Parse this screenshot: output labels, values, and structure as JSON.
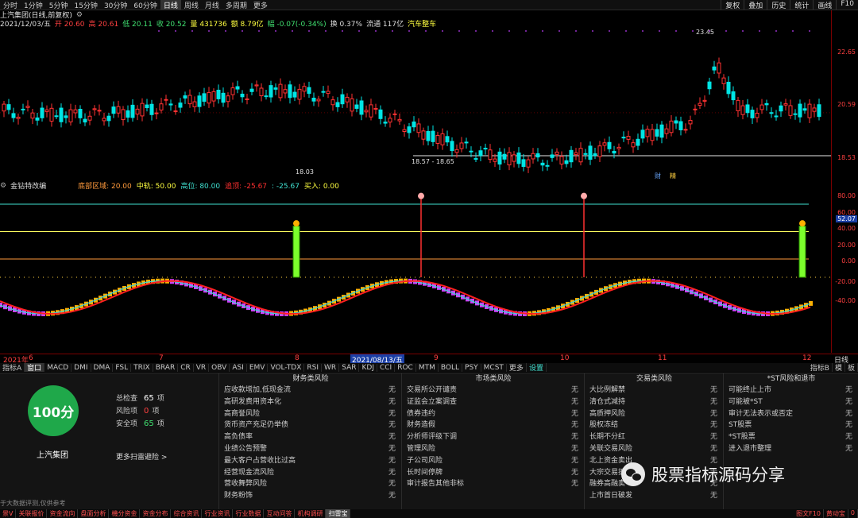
{
  "topbar": {
    "periods": [
      "分时",
      "1分钟",
      "5分钟",
      "15分钟",
      "30分钟",
      "60分钟",
      "日线",
      "周线",
      "月线",
      "多周期",
      "更多"
    ],
    "active": "日线",
    "right": [
      "复权",
      "叠加",
      "历史",
      "统计",
      "画线",
      "F10"
    ]
  },
  "stock": {
    "title": "上汽集团(日线,前复权)",
    "info_date": "2021/12/03/五",
    "open": "开 20.60",
    "high": "高 20.61",
    "low": "低 20.11",
    "close": "收 20.52",
    "volume": "量 431736",
    "amount": "额 8.79亿",
    "change": "幅 -0.07(-0.34%)",
    "turnover": "换 0.37%",
    "float": "流通 117亿",
    "sector": "汽车整车"
  },
  "price_chart": {
    "y_labels": [
      "22.65",
      "20.59",
      "18.53"
    ],
    "max_label": "23.45",
    "min_label": "18.03",
    "range_label": "18.57 - 18.65",
    "marks": [
      "财",
      "精"
    ]
  },
  "indicator": {
    "name": "金钻特改编",
    "params": [
      {
        "text": "底部区域: 20.00",
        "color": "#ff9a3c"
      },
      {
        "text": "中轨: 50.00",
        "color": "#ffff40"
      },
      {
        "text": "高位: 80.00",
        "color": "#40e0d0"
      },
      {
        "text": "追顶: -25.67",
        "color": "#ff3030"
      },
      {
        "text": ": -25.67",
        "color": "#40e0d0"
      },
      {
        "text": "买入: 0.00",
        "color": "#ffff40"
      }
    ],
    "y_labels": [
      "80.00",
      "60.00",
      "40.00",
      "20.00",
      "0.00",
      "-20.00",
      "-40.00"
    ],
    "current_value": "52.07"
  },
  "chart_data": {
    "type": "candlestick",
    "x_ticks": [
      "2021年",
      "6",
      "7",
      "8",
      "2021/08/13/五",
      "9",
      "10",
      "11",
      "12"
    ],
    "price_axis": [
      18.53,
      23.45
    ]
  },
  "xaxis_right": "日线",
  "tabs": [
    "指标A",
    "窗口",
    "MACD",
    "DMI",
    "DMA",
    "FSL",
    "TRIX",
    "BRAR",
    "CR",
    "VR",
    "OBV",
    "ASI",
    "EMV",
    "VOL-TDX",
    "RSI",
    "WR",
    "SAR",
    "KDJ",
    "CCI",
    "ROC",
    "MTM",
    "BOLL",
    "PSY",
    "MCST",
    "更多",
    "设置"
  ],
  "tabs_right": [
    "指标B",
    "模",
    "板"
  ],
  "risk": {
    "score": "100分",
    "stats": [
      {
        "label": "总检查",
        "value": "65",
        "unit": "项",
        "color": "#ffffff"
      },
      {
        "label": "风险项",
        "value": "0",
        "unit": "项",
        "color": "#ff4040"
      },
      {
        "label": "安全项",
        "value": "65",
        "unit": "项",
        "color": "#40e070"
      }
    ],
    "company": "上汽集团",
    "more_link": "更多扫雷避险 >",
    "source": "于大数据评测,仅供参考",
    "columns": [
      {
        "title": "财务类风险",
        "items": [
          "应收款增加,低现金流",
          "高研发费用资本化",
          "高商誉风险",
          "货币资产充足仍举债",
          "高负债率",
          "业绩公告预警",
          "最大客户占营收比过高",
          "经营现金流风险",
          "营收舞弊风险",
          "财务粉饰"
        ]
      },
      {
        "title": "市场类风险",
        "items": [
          "交易所公开谴责",
          "证监会立案调查",
          "债券违约",
          "财务造假",
          "分析师评级下调",
          "管理风险",
          "子公司风险",
          "长时间停牌",
          "审计报告其他非标"
        ]
      },
      {
        "title": "交易类风险",
        "items": [
          "大比例解禁",
          "清仓式减持",
          "高质押风险",
          "股权冻结",
          "长期不分红",
          "关联交易风险",
          "北上资金卖出",
          "大宗交易折",
          "融券高融卖",
          "上市首日破发"
        ]
      },
      {
        "title": "*ST风险和退市",
        "items": [
          "可能终止上市",
          "可能被*ST",
          "审计无法表示或否定",
          "ST股票",
          "*ST股票",
          "进入退市整理"
        ]
      }
    ],
    "none_label": "无"
  },
  "watermark": "股票指标源码分享",
  "bottombar": {
    "items": [
      "景V",
      "关联报价",
      "资金流向",
      "盘面分析",
      "機分资金",
      "资金分布",
      "综合资讯",
      "行业资讯",
      "行业数据",
      "互动问答",
      "机构调研",
      "扫雷宝"
    ],
    "right": [
      "图文F10",
      "黄动宝",
      "0"
    ]
  }
}
